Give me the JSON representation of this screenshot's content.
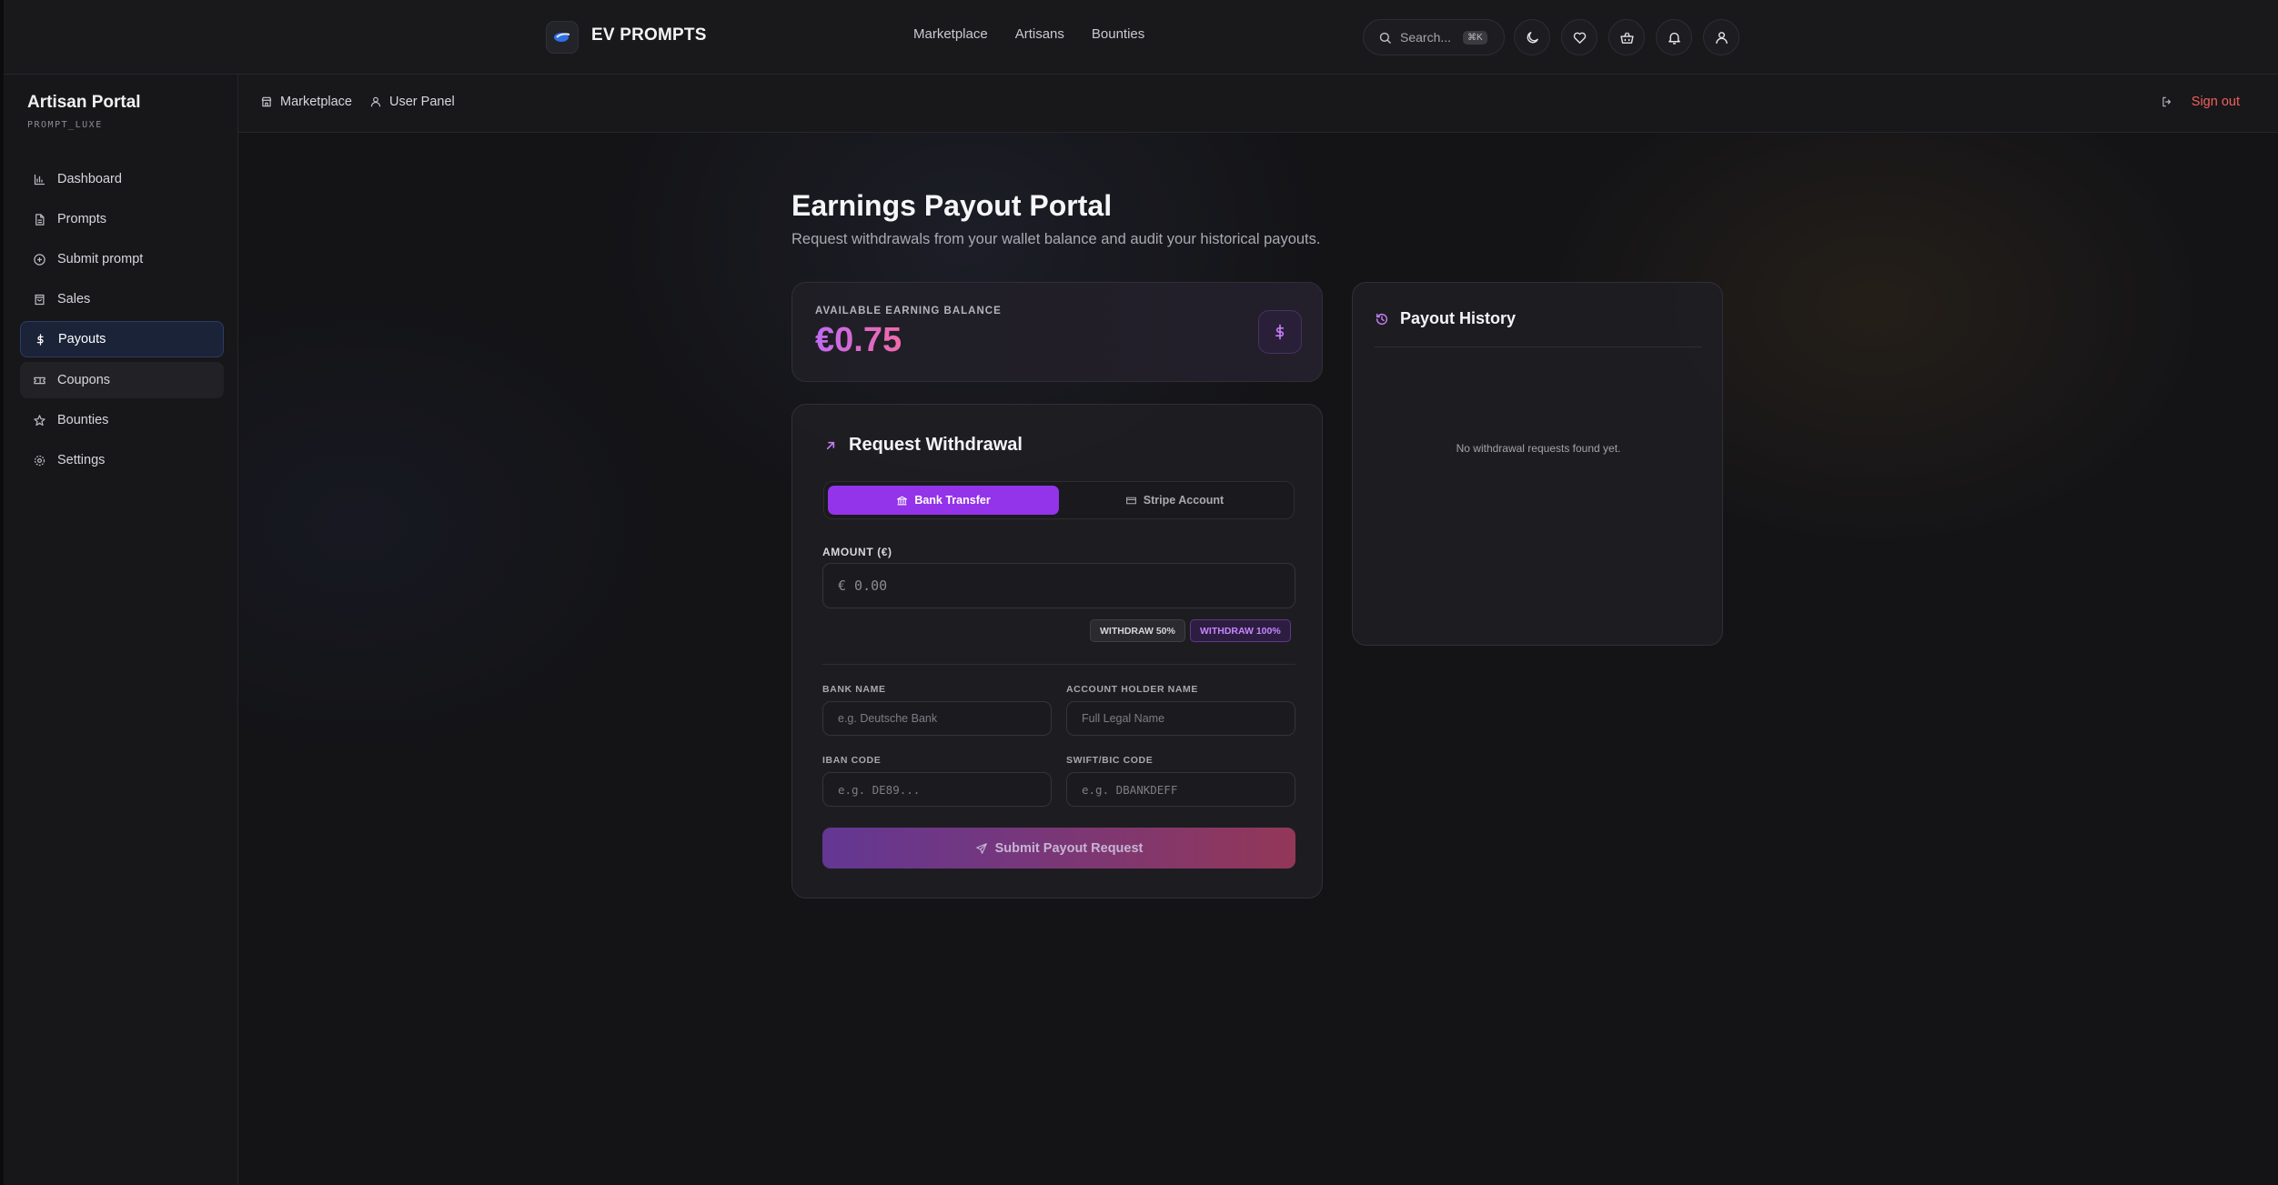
{
  "brand": {
    "name": "EV PROMPTS"
  },
  "top_nav": {
    "items": [
      "Marketplace",
      "Artisans",
      "Bounties"
    ]
  },
  "search": {
    "placeholder": "Search...",
    "shortcut": "⌘K"
  },
  "top_icons": [
    "moon-icon",
    "heart-icon",
    "basket-icon",
    "bell-icon",
    "user-icon"
  ],
  "sidebar": {
    "title": "Artisan Portal",
    "subtitle": "PROMPT_LUXE",
    "items": [
      {
        "label": "Dashboard",
        "icon": "bar-chart-icon"
      },
      {
        "label": "Prompts",
        "icon": "file-icon"
      },
      {
        "label": "Submit prompt",
        "icon": "plus-circle-icon"
      },
      {
        "label": "Sales",
        "icon": "bag-icon"
      },
      {
        "label": "Payouts",
        "icon": "dollar-icon",
        "active": true
      },
      {
        "label": "Coupons",
        "icon": "ticket-icon"
      },
      {
        "label": "Bounties",
        "icon": "star-icon"
      },
      {
        "label": "Settings",
        "icon": "gear-icon"
      }
    ]
  },
  "subheader": {
    "crumb_marketplace": "Marketplace",
    "crumb_panel": "User Panel",
    "signout": "Sign out"
  },
  "page": {
    "title": "Earnings Payout Portal",
    "subtitle": "Request withdrawals from your wallet balance and audit your historical payouts."
  },
  "balance": {
    "label": "AVAILABLE EARNING BALANCE",
    "value": "€0.75"
  },
  "withdrawal": {
    "title": "Request Withdrawal",
    "methods": {
      "bank": "Bank Transfer",
      "stripe": "Stripe Account",
      "selected": "Bank Transfer"
    },
    "amount_label": "AMOUNT (€)",
    "amount_placeholder": "€ 0.00",
    "pill_50": "WITHDRAW 50%",
    "pill_100": "WITHDRAW 100%",
    "bank_name_label": "BANK NAME",
    "bank_name_placeholder": "e.g. Deutsche Bank",
    "holder_label": "ACCOUNT HOLDER NAME",
    "holder_placeholder": "Full Legal Name",
    "iban_label": "IBAN CODE",
    "iban_placeholder": "e.g. DE89...",
    "swift_label": "SWIFT/BIC CODE",
    "swift_placeholder": "e.g. DBANKDEFF",
    "submit": "Submit Payout Request"
  },
  "history": {
    "title": "Payout History",
    "empty": "No withdrawal requests found yet."
  },
  "colors": {
    "accent": "#9333ea",
    "signout": "#f0605d",
    "active_nav": "#1b2338"
  }
}
